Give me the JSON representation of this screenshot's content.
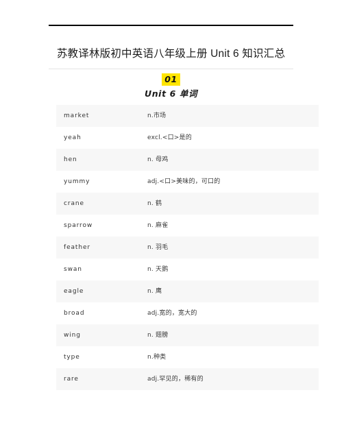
{
  "document": {
    "title": "苏教译林版初中英语八年级上册 Unit 6 知识汇总"
  },
  "section": {
    "number": "01",
    "number_highlight_color": "#ffe500",
    "subtitle": "Unit 6 单词"
  },
  "vocab_table": {
    "rows": [
      {
        "word": "market",
        "meaning": "n.市场"
      },
      {
        "word": "yeah",
        "meaning": "excl.<口>是的"
      },
      {
        "word": "hen",
        "meaning": "n. 母鸡"
      },
      {
        "word": "yummy",
        "meaning": "adj.<口>美味的，可口的"
      },
      {
        "word": "crane",
        "meaning": "n. 鹤"
      },
      {
        "word": "sparrow",
        "meaning": "n. 麻雀"
      },
      {
        "word": "feather",
        "meaning": "n. 羽毛"
      },
      {
        "word": "swan",
        "meaning": "n. 天鹅"
      },
      {
        "word": "eagle",
        "meaning": "n. 鹰"
      },
      {
        "word": "broad",
        "meaning": "adj.宽的，宽大的"
      },
      {
        "word": "wing",
        "meaning": "n. 翅膀"
      },
      {
        "word": "type",
        "meaning": "n.种类"
      },
      {
        "word": "rare",
        "meaning": "adj.罕见的，稀有的"
      }
    ]
  }
}
